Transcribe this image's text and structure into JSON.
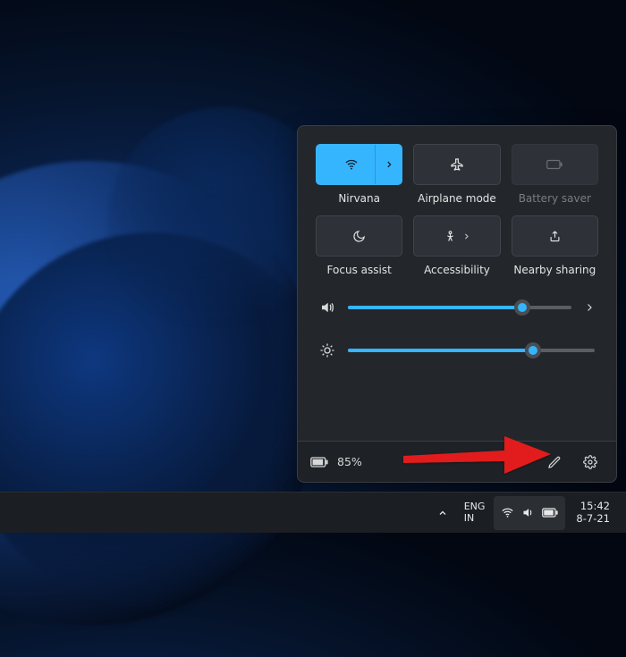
{
  "quick_settings": {
    "tiles": [
      {
        "name": "wifi",
        "label": "Nirvana",
        "icon": "wifi",
        "active": true,
        "has_expand": true,
        "disabled": false
      },
      {
        "name": "airplane",
        "label": "Airplane mode",
        "icon": "airplane",
        "active": false,
        "has_expand": false,
        "disabled": false
      },
      {
        "name": "battery-saver",
        "label": "Battery saver",
        "icon": "battery",
        "active": false,
        "has_expand": false,
        "disabled": true
      },
      {
        "name": "focus-assist",
        "label": "Focus assist",
        "icon": "moon",
        "active": false,
        "has_expand": false,
        "disabled": false
      },
      {
        "name": "accessibility",
        "label": "Accessibility",
        "icon": "person",
        "active": false,
        "has_expand": true,
        "disabled": false
      },
      {
        "name": "nearby-share",
        "label": "Nearby sharing",
        "icon": "share",
        "active": false,
        "has_expand": false,
        "disabled": false
      }
    ],
    "volume_percent": 78,
    "brightness_percent": 75,
    "battery_text": "85%"
  },
  "taskbar": {
    "lang_primary": "ENG",
    "lang_secondary": "IN",
    "time": "15:42",
    "date": "8-7-21"
  },
  "colors": {
    "accent": "#36b5ff",
    "panel": "#23262b"
  }
}
